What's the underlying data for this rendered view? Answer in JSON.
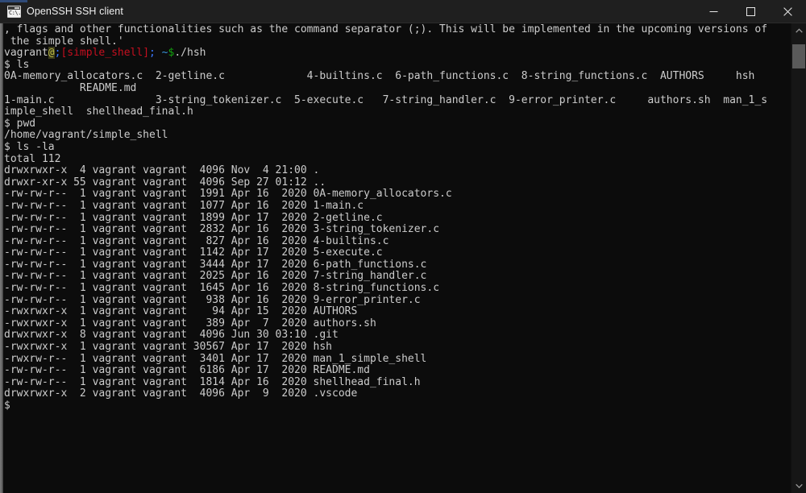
{
  "window": {
    "title": "OpenSSH SSH client",
    "icon": "console-window-icon",
    "icon_glyph": "C:\\.",
    "controls": [
      {
        "name": "minimize-button",
        "label": "Minimize"
      },
      {
        "name": "maximize-button",
        "label": "Maximize"
      },
      {
        "name": "close-button",
        "label": "Close"
      }
    ],
    "colors": {
      "titlebar_bg": "#1f1f1f",
      "terminal_bg": "#0c0c0c",
      "foreground": "#cccccc",
      "prompt_red": "#c50f1f",
      "prompt_blue": "#3b78ff",
      "prompt_green": "#13a10e",
      "scrollbar_thumb": "#5a5a5a"
    }
  },
  "scrollbar": {
    "up_arrow": "scroll-up-arrow",
    "down_arrow": "scroll-down-arrow",
    "thumb": "scroll-thumb"
  },
  "terminal": {
    "lines": [
      {
        "type": "text",
        "text": ", flags and other functionalities such as the command separator (;). This will be implemented in the upcoming versions of"
      },
      {
        "type": "text",
        "text": " the simple shell.'"
      },
      {
        "type": "prompt",
        "segments": [
          {
            "text": "vagrant",
            "cls": "c-white"
          },
          {
            "text": "@",
            "cls": "c-at"
          },
          {
            "text": ";",
            "cls": "c-cyan"
          },
          {
            "text": "[simple_shell]",
            "cls": "c-red"
          },
          {
            "text": ";",
            "cls": "c-cyan"
          },
          {
            "text": " ~",
            "cls": "c-teal"
          },
          {
            "text": "$",
            "cls": "c-green"
          },
          {
            "text": "./hsh",
            "cls": "c-white"
          }
        ]
      },
      {
        "type": "text",
        "text": "$ ls"
      },
      {
        "type": "text",
        "text": "0A-memory_allocators.c  2-getline.c             4-builtins.c  6-path_functions.c  8-string_functions.c  AUTHORS     hsh"
      },
      {
        "type": "text",
        "text": "            README.md"
      },
      {
        "type": "text",
        "text": "1-main.c                3-string_tokenizer.c  5-execute.c   7-string_handler.c  9-error_printer.c     authors.sh  man_1_s"
      },
      {
        "type": "text",
        "text": "imple_shell  shellhead_final.h"
      },
      {
        "type": "text",
        "text": "$ pwd"
      },
      {
        "type": "text",
        "text": "/home/vagrant/simple_shell"
      },
      {
        "type": "text",
        "text": "$ ls -la"
      },
      {
        "type": "text",
        "text": "total 112"
      },
      {
        "type": "text",
        "text": "drwxrwxr-x  4 vagrant vagrant  4096 Nov  4 21:00 ."
      },
      {
        "type": "text",
        "text": "drwxr-xr-x 55 vagrant vagrant  4096 Sep 27 01:12 .."
      },
      {
        "type": "text",
        "text": "-rw-rw-r--  1 vagrant vagrant  1991 Apr 16  2020 0A-memory_allocators.c"
      },
      {
        "type": "text",
        "text": "-rw-rw-r--  1 vagrant vagrant  1077 Apr 16  2020 1-main.c"
      },
      {
        "type": "text",
        "text": "-rw-rw-r--  1 vagrant vagrant  1899 Apr 17  2020 2-getline.c"
      },
      {
        "type": "text",
        "text": "-rw-rw-r--  1 vagrant vagrant  2832 Apr 16  2020 3-string_tokenizer.c"
      },
      {
        "type": "text",
        "text": "-rw-rw-r--  1 vagrant vagrant   827 Apr 16  2020 4-builtins.c"
      },
      {
        "type": "text",
        "text": "-rw-rw-r--  1 vagrant vagrant  1142 Apr 17  2020 5-execute.c"
      },
      {
        "type": "text",
        "text": "-rw-rw-r--  1 vagrant vagrant  3444 Apr 17  2020 6-path_functions.c"
      },
      {
        "type": "text",
        "text": "-rw-rw-r--  1 vagrant vagrant  2025 Apr 16  2020 7-string_handler.c"
      },
      {
        "type": "text",
        "text": "-rw-rw-r--  1 vagrant vagrant  1645 Apr 16  2020 8-string_functions.c"
      },
      {
        "type": "text",
        "text": "-rw-rw-r--  1 vagrant vagrant   938 Apr 16  2020 9-error_printer.c"
      },
      {
        "type": "text",
        "text": "-rwxrwxr-x  1 vagrant vagrant    94 Apr 15  2020 AUTHORS"
      },
      {
        "type": "text",
        "text": "-rwxrwxr-x  1 vagrant vagrant   389 Apr  7  2020 authors.sh"
      },
      {
        "type": "text",
        "text": "drwxrwxr-x  8 vagrant vagrant  4096 Jun 30 03:10 .git"
      },
      {
        "type": "text",
        "text": "-rwxrwxr-x  1 vagrant vagrant 30567 Apr 17  2020 hsh"
      },
      {
        "type": "text",
        "text": "-rwxrw-r--  1 vagrant vagrant  3401 Apr 17  2020 man_1_simple_shell"
      },
      {
        "type": "text",
        "text": "-rw-rw-r--  1 vagrant vagrant  6186 Apr 17  2020 README.md"
      },
      {
        "type": "text",
        "text": "-rw-rw-r--  1 vagrant vagrant  1814 Apr 16  2020 shellhead_final.h"
      },
      {
        "type": "text",
        "text": "drwxrwxr-x  2 vagrant vagrant  4096 Apr  9  2020 .vscode"
      },
      {
        "type": "text",
        "text": "$"
      }
    ]
  }
}
